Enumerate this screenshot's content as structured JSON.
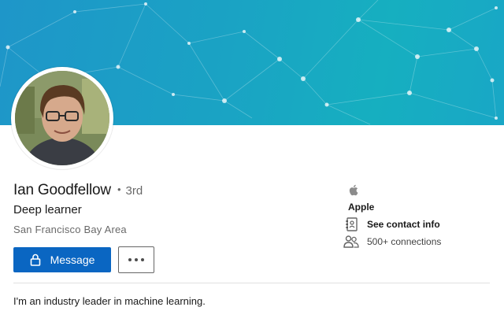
{
  "profile": {
    "name": "Ian Goodfellow",
    "degree": "3rd",
    "headline": "Deep learner",
    "location": "San Francisco Bay Area",
    "about": "I'm an industry leader in machine learning."
  },
  "actions": {
    "message_label": "Message",
    "more_icon": "more-horizontal-icon"
  },
  "sidebar": {
    "company_icon": "apple-logo-icon",
    "company": "Apple",
    "contact_icon": "address-book-icon",
    "contact_label": "See contact info",
    "connections_icon": "people-icon",
    "connections_label": "500+ connections"
  },
  "colors": {
    "banner_start": "#1e96c9",
    "banner_end": "#16afc0",
    "primary_button": "#0a66c2"
  }
}
